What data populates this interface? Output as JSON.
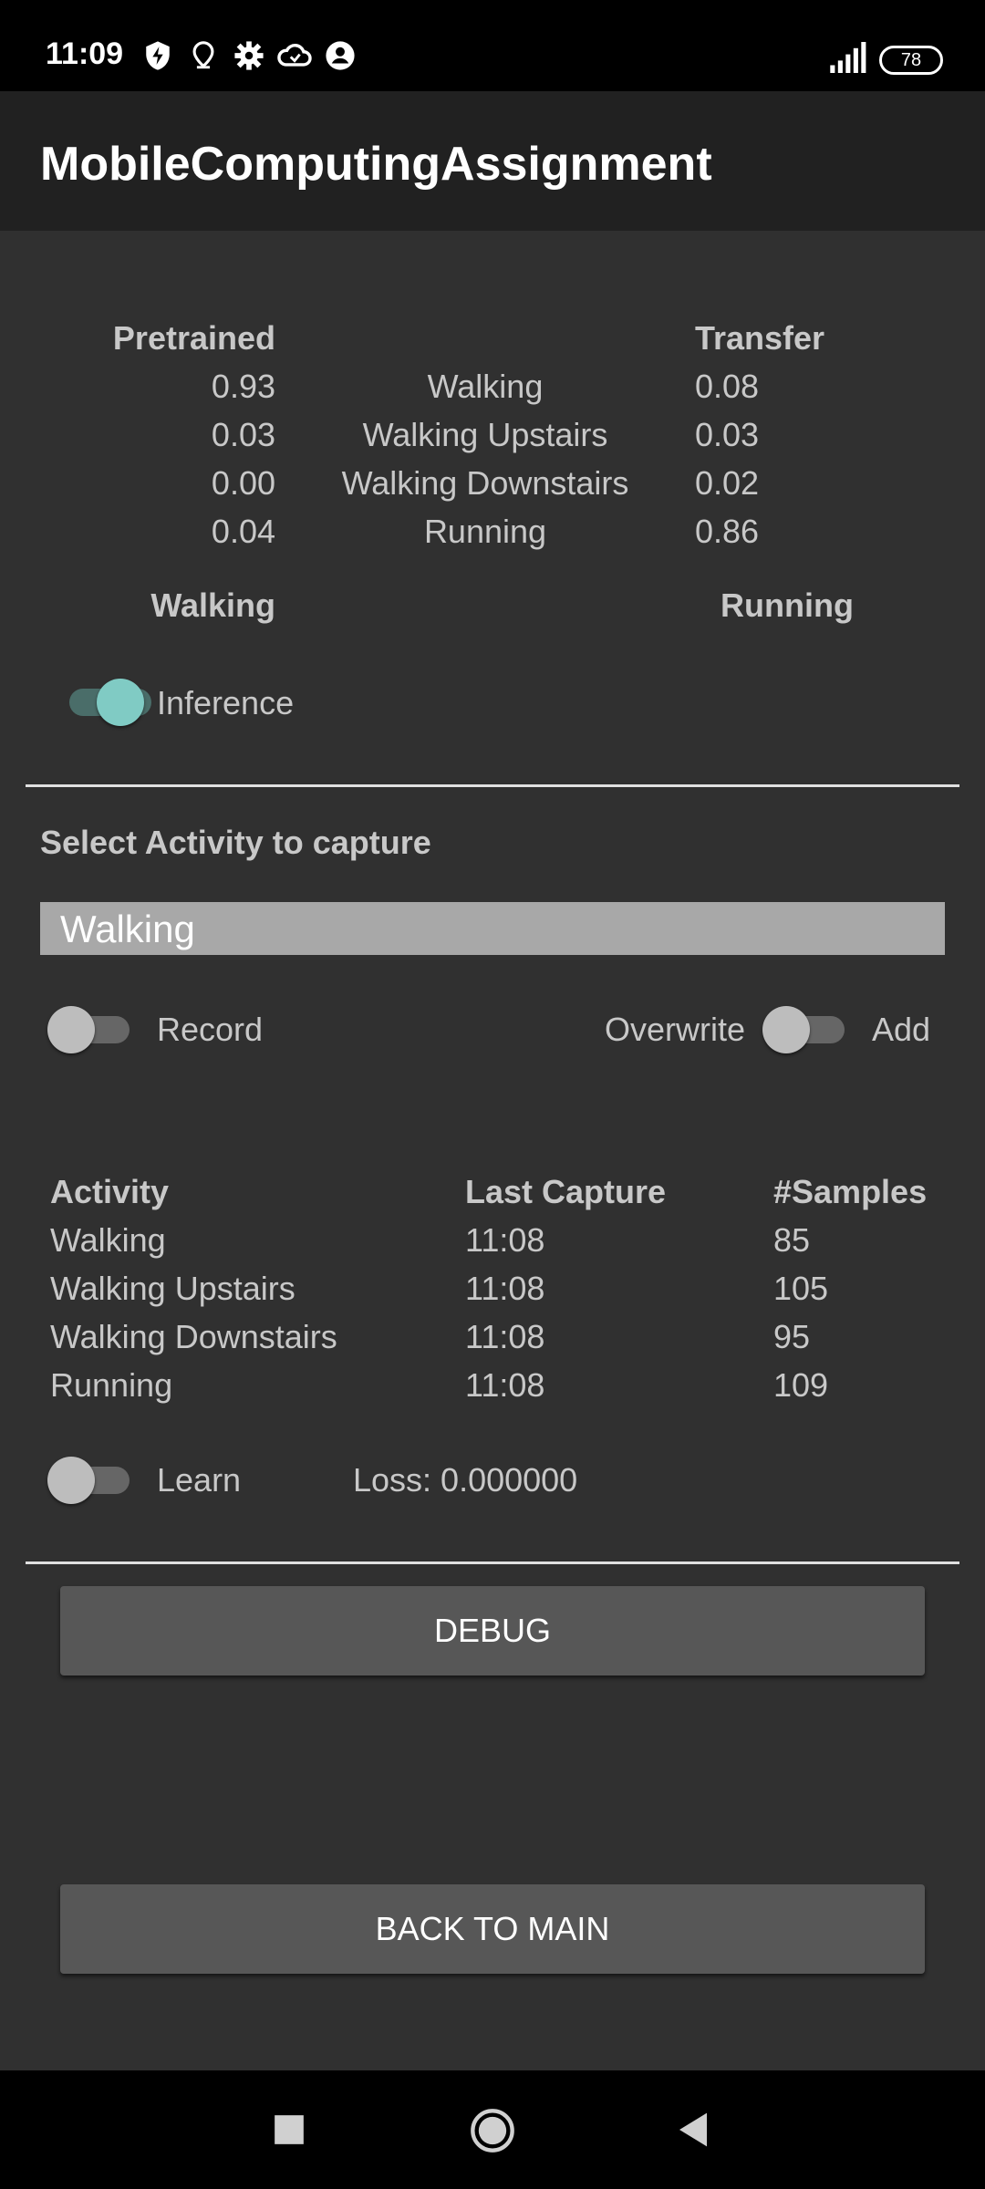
{
  "status_bar": {
    "time": "11:09",
    "battery": "78"
  },
  "app_bar": {
    "title": "MobileComputingAssignment"
  },
  "inference": {
    "pretrained_header": "Pretrained",
    "transfer_header": "Transfer",
    "rows": [
      {
        "pretrained": "0.93",
        "activity": "Walking",
        "transfer": "0.08"
      },
      {
        "pretrained": "0.03",
        "activity": "Walking Upstairs",
        "transfer": "0.03"
      },
      {
        "pretrained": "0.00",
        "activity": "Walking Downstairs",
        "transfer": "0.02"
      },
      {
        "pretrained": "0.04",
        "activity": "Running",
        "transfer": "0.86"
      }
    ],
    "pretrained_result": "Walking",
    "transfer_result": "Running",
    "toggle_label": "Inference",
    "toggle_on": true
  },
  "capture": {
    "section_title": "Select Activity to capture",
    "selected_activity": "Walking",
    "record_label": "Record",
    "overwrite_label": "Overwrite",
    "add_label": "Add"
  },
  "samples": {
    "headers": {
      "activity": "Activity",
      "last_capture": "Last Capture",
      "samples": "#Samples"
    },
    "rows": [
      {
        "activity": "Walking",
        "last_capture": "11:08",
        "samples": "85"
      },
      {
        "activity": "Walking Upstairs",
        "last_capture": "11:08",
        "samples": "105"
      },
      {
        "activity": "Walking Downstairs",
        "last_capture": "11:08",
        "samples": "95"
      },
      {
        "activity": "Running",
        "last_capture": "11:08",
        "samples": "109"
      }
    ]
  },
  "learn": {
    "label": "Learn",
    "loss": "Loss: 0.000000"
  },
  "buttons": {
    "debug": "DEBUG",
    "back": "BACK TO MAIN"
  },
  "colors": {
    "accent": "#80cbc4",
    "background": "#303030",
    "app_bar": "#212121"
  }
}
